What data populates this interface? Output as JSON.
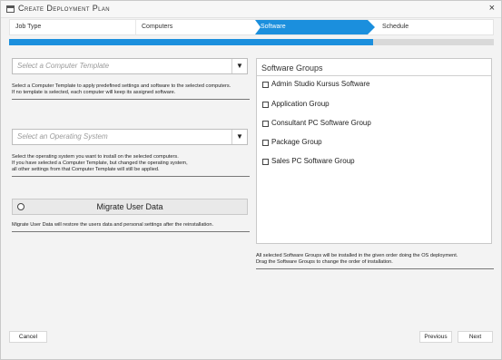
{
  "window": {
    "title": "Create Deployment Plan",
    "title_icon": "window-icon",
    "close_glyph": "×"
  },
  "steps": [
    {
      "label": "Job Type"
    },
    {
      "label": "Computers"
    },
    {
      "label": "Software",
      "active": true
    },
    {
      "label": "Schedule"
    }
  ],
  "progress": {
    "fraction": 0.75,
    "color": "#1b8fdd"
  },
  "colors": {
    "accent": "#1b8fdd"
  },
  "computer_template": {
    "placeholder": "Select a Computer Template",
    "arrow_glyph": "▼",
    "help_line1": "Select a Computer Template to apply predefined settings and software to the selected computers.",
    "help_line2": "If no template is selected, each computer will keep its assigned software."
  },
  "operating_system": {
    "placeholder": "Select an Operating System",
    "arrow_glyph": "▼",
    "help_line1": "Select the operating system you want to install on the selected computers.",
    "help_line2": "If you have selected a Computer Template, but changed the operating system,",
    "help_line3": "all other settings from that Computer Template will still be applied."
  },
  "migrate": {
    "label": "Migrate User Data",
    "help": "Migrate User Data will restore the users data and personal settings after the reinstallation."
  },
  "software_groups": {
    "title": "Software Groups",
    "items": [
      {
        "label": "Admin Studio Kursus Software",
        "checked": false
      },
      {
        "label": "Application Group",
        "checked": false
      },
      {
        "label": "Consultant PC Software Group",
        "checked": false
      },
      {
        "label": "Package Group",
        "checked": false
      },
      {
        "label": "Sales PC Software Group",
        "checked": false
      }
    ],
    "help_line1": "All selected Software Groups will be installed in the given order doing the OS deployment.",
    "help_line2": "Drag the Software Groups to change the order of installation."
  },
  "buttons": {
    "cancel": "Cancel",
    "previous": "Previous",
    "next": "Next"
  }
}
